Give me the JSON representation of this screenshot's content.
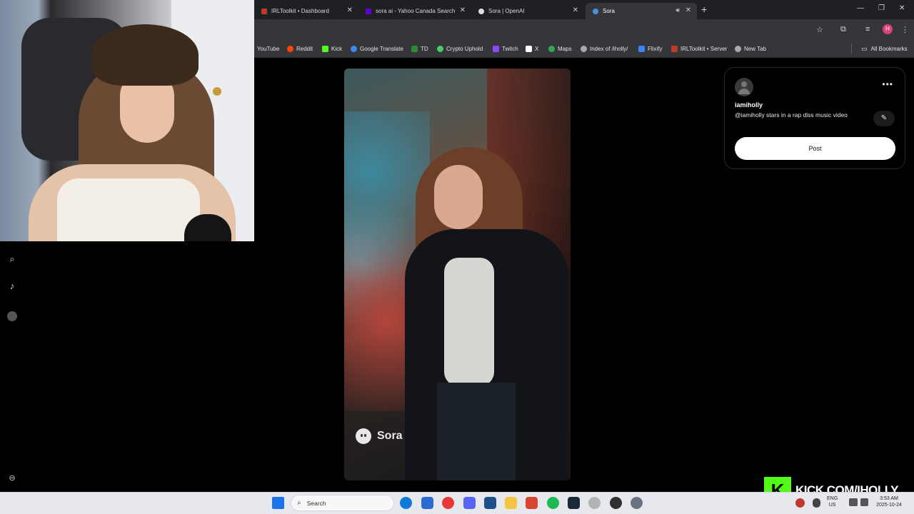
{
  "browser": {
    "tabs": [
      {
        "title": "IRLToolkit • Dashboard",
        "favicon_color": "#c0392b"
      },
      {
        "title": "sora ai - Yahoo Canada Search",
        "favicon_color": "#6001d2"
      },
      {
        "title": "Sora | OpenAI",
        "favicon_color": "#dddddd"
      },
      {
        "title": "Sora",
        "favicon_color": "#4a90e2"
      }
    ],
    "bookmarks": [
      {
        "label": "YouTube",
        "color": "#ff0000"
      },
      {
        "label": "Reddit",
        "color": "#ff4500"
      },
      {
        "label": "Kick",
        "color": "#53fc18"
      },
      {
        "label": "Google Translate",
        "color": "#4285f4"
      },
      {
        "label": "TD",
        "color": "#2e8b3a"
      },
      {
        "label": "Crypto Uphold",
        "color": "#49cc68"
      },
      {
        "label": "Twitch",
        "color": "#9146ff"
      },
      {
        "label": "X",
        "color": "#ffffff"
      },
      {
        "label": "Maps",
        "color": "#34a853"
      },
      {
        "label": "Index of /iholly/",
        "color": "#aaaaaa"
      },
      {
        "label": "Flixify",
        "color": "#3b82f6"
      },
      {
        "label": "IRLToolkit • Server",
        "color": "#c0392b"
      },
      {
        "label": "New Tab",
        "color": "#aaaaaa"
      }
    ],
    "all_bookmarks": "All Bookmarks",
    "profile_initial": "H"
  },
  "video": {
    "watermark": "Sora"
  },
  "post_card": {
    "username": "iamiholly",
    "caption": "@iamiholly stars in a rap diss music video",
    "post_button": "Post"
  },
  "overlay": {
    "kick_url": "KICK.COM/IHOLLY",
    "kick_logo": "K"
  },
  "taskbar": {
    "search_placeholder": "Search",
    "lang_top": "ENG",
    "lang_bottom": "US",
    "time": "3:53 AM",
    "date": "2025-10-24"
  },
  "colors": {
    "kick_green": "#53fc18",
    "profile_pink": "#d8407a",
    "chrome_dark": "#35363a"
  }
}
